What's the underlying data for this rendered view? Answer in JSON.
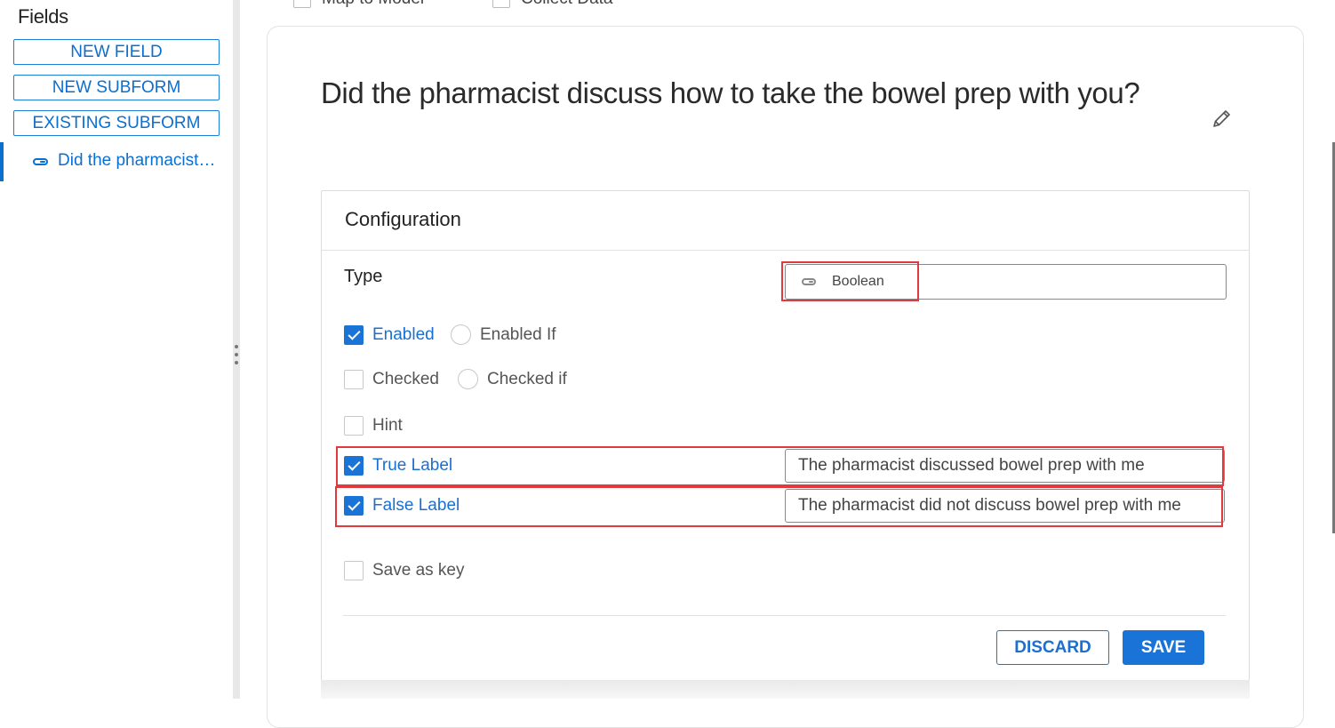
{
  "sidebar": {
    "title": "Fields",
    "buttons": [
      {
        "label": "NEW FIELD"
      },
      {
        "label": "NEW SUBFORM"
      },
      {
        "label": "EXISTING SUBFORM"
      }
    ],
    "selected_item": {
      "label": "Did the pharmacist…",
      "icon": "toggle-icon"
    }
  },
  "top_options": [
    {
      "label": "Map to Model",
      "checked": false
    },
    {
      "label": "Collect Data",
      "checked": false
    }
  ],
  "field": {
    "question": "Did the pharmacist discuss how to take the bowel prep with you?",
    "edit_icon": "pencil-icon"
  },
  "configuration": {
    "title": "Configuration",
    "type_label": "Type",
    "type_value": "Boolean",
    "enabled": {
      "label": "Enabled",
      "checked": true
    },
    "enabled_if": {
      "label": "Enabled If",
      "checked": false
    },
    "checked": {
      "label": "Checked",
      "checked": false
    },
    "checked_if": {
      "label": "Checked if",
      "checked": false
    },
    "hint": {
      "label": "Hint",
      "checked": false
    },
    "true_label": {
      "label": "True Label",
      "checked": true,
      "value": "The pharmacist discussed bowel prep with me"
    },
    "false_label": {
      "label": "False Label",
      "checked": true,
      "value": "The pharmacist did not discuss bowel prep with me"
    },
    "save_as_key": {
      "label": "Save as key",
      "checked": false
    },
    "discard_label": "DISCARD",
    "save_label": "SAVE"
  },
  "colors": {
    "accent": "#1a73d6",
    "highlight": "#e0393e"
  }
}
